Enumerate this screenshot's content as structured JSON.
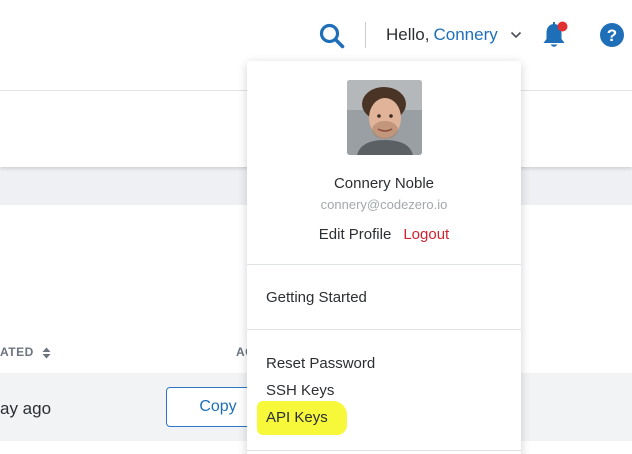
{
  "header": {
    "greeting_prefix": "Hello,",
    "user_first_name": "Connery",
    "icons": [
      "search-icon",
      "chevron-down-icon",
      "bell-icon",
      "help-icon"
    ],
    "notification_dot_color": "#e03030",
    "accent_color": "#1f6fb8"
  },
  "table": {
    "columns": [
      "ATED",
      "AC"
    ],
    "rows": [
      {
        "time": "ay ago",
        "action_label": "Copy"
      }
    ]
  },
  "dropdown": {
    "user": {
      "name": "Connery Noble",
      "email": "connery@codezero.io"
    },
    "edit_profile_label": "Edit Profile",
    "logout_label": "Logout",
    "logout_color": "#d3212f",
    "section1": [
      "Getting Started"
    ],
    "section2": [
      "Reset Password",
      "SSH Keys",
      "API Keys"
    ],
    "highlighted_item": "API Keys",
    "highlight_color": "#f7f83a"
  }
}
